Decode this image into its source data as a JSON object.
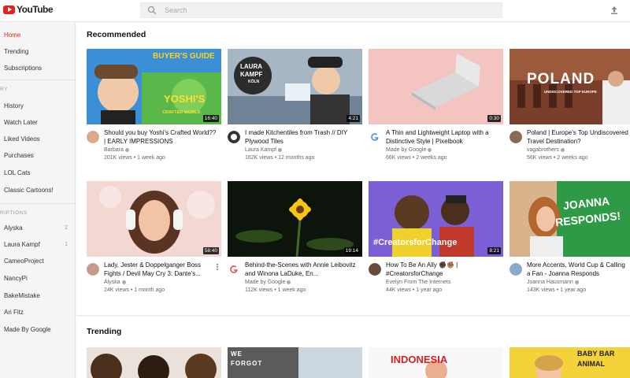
{
  "header": {
    "logo_text": "YouTube",
    "search_placeholder": "Search",
    "icons": {
      "logo": "youtube-logo-icon",
      "search": "search-icon",
      "upload": "upload-icon"
    }
  },
  "sidebar": {
    "main_items": [
      {
        "label": "Home",
        "active": true
      },
      {
        "label": "Trending"
      },
      {
        "label": "Subscriptions"
      }
    ],
    "library_heading": "RY",
    "library_items": [
      {
        "label": "History"
      },
      {
        "label": "Watch Later"
      },
      {
        "label": "Liked Videos"
      },
      {
        "label": "Purchases"
      },
      {
        "label": "LOL Cats"
      },
      {
        "label": "Classic Cartoons!"
      }
    ],
    "subscriptions_heading": "RIPTIONS",
    "subscriptions_items": [
      {
        "label": "Alyska",
        "count": "2"
      },
      {
        "label": "Laura Kampf",
        "count": "1"
      },
      {
        "label": "CameoProject"
      },
      {
        "label": "NancyPi"
      },
      {
        "label": "BakeMistake"
      },
      {
        "label": "Ari Fitz"
      },
      {
        "label": "Made By Google"
      }
    ]
  },
  "recommended": {
    "title": "Recommended",
    "videos": [
      {
        "title": "Should you buy Yoshi's Crafted World?? | EARLY IMPRESSIONS",
        "channel": "Barbara",
        "meta": "201K views • 1 week ago",
        "duration": "16:40",
        "thumb_text": "BUYER'S GUIDE",
        "thumb_text2": "YOSHI'S",
        "thumb_text3": "CRAFTED WORLD"
      },
      {
        "title": "I made Kitchentiles from Trash // DIY Plywood Tiles",
        "channel": "Laura Kampf",
        "meta": "162K views • 12 months ago",
        "duration": "4:21",
        "thumb_text": "LAURA",
        "thumb_text2": "KAMPF",
        "thumb_text3": "KÖLN"
      },
      {
        "title": "A Thin and Lightweight Laptop with a Distinctive Style | Pixelbook",
        "channel": "Made by Google",
        "meta": "66K views • 2 weeks ago",
        "duration": "0:30"
      },
      {
        "title": "Poland | Europe's Top Undiscovered Travel Destination?",
        "channel": "vagabrothers",
        "meta": "56K views • 2 weeks ago",
        "duration": "",
        "thumb_text": "POLAND",
        "thumb_text2": "UNDISCOVERED TOP EUROPE"
      },
      {
        "title": "Lady, Jester & Doppelganger Boss Fights / Devil May Cry 3: Dante's...",
        "channel": "Alyska",
        "meta": "24K views • 1 month ago",
        "duration": "58:40"
      },
      {
        "title": "Behind-the-Scenes with Annie Leibovitz and Winona LaDuke, En...",
        "channel": "Made by Google",
        "meta": "112K views • 1 week ago",
        "duration": "19:14"
      },
      {
        "title": "How To Be An Ally ✊🏿✊🏽 | #CreatorsforChange",
        "channel": "Evelyn From The Internets",
        "meta": "44K views • 1 year ago",
        "duration": "8:21",
        "thumb_text": "#CreatorsforChange"
      },
      {
        "title": "More Accents, World Cup & Calling a Fan - Joanna Responds",
        "channel": "Joanna Hausmann",
        "meta": "143K views • 1 year ago",
        "duration": "",
        "thumb_text": "JOANNA",
        "thumb_text2": "RESPONDS!"
      }
    ]
  },
  "trending": {
    "title": "Trending",
    "thumbs": [
      {
        "thumb_text": ""
      },
      {
        "thumb_text": "WE",
        "thumb_text2": "FORGOT"
      },
      {
        "thumb_text": "INDONESIA"
      },
      {
        "thumb_text": "BABY BAR",
        "thumb_text2": "ANIMAL"
      }
    ]
  },
  "colors": {
    "accent": "#e62117",
    "sidebar_bg": "#f5f5f5",
    "text_secondary": "#666666"
  }
}
